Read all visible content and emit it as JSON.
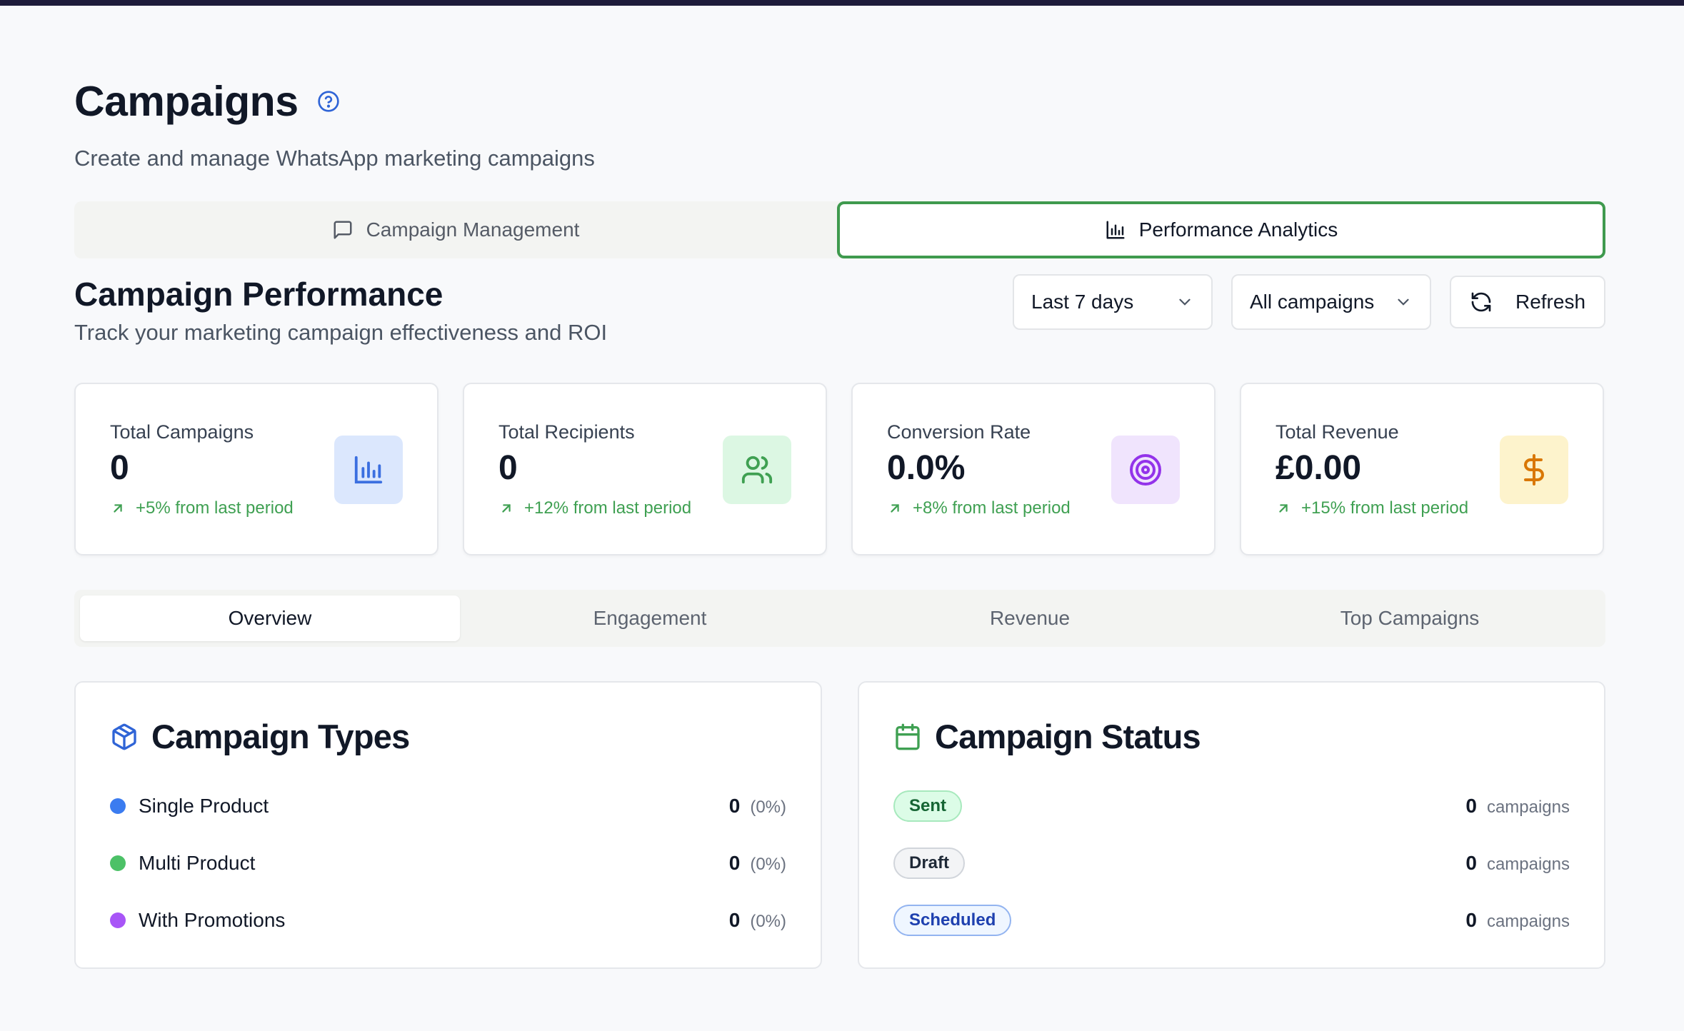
{
  "header": {
    "title": "Campaigns",
    "subtitle": "Create and manage WhatsApp marketing campaigns"
  },
  "main_tabs": [
    {
      "label": "Campaign Management",
      "icon": "message-square-icon",
      "active": false
    },
    {
      "label": "Performance Analytics",
      "icon": "bar-chart-icon",
      "active": true
    }
  ],
  "section": {
    "title": "Campaign Performance",
    "subtitle": "Track your marketing campaign effectiveness and ROI"
  },
  "controls": {
    "range": "Last 7 days",
    "campaign_filter": "All campaigns",
    "refresh_label": "Refresh"
  },
  "stats": [
    {
      "label": "Total Campaigns",
      "value": "0",
      "change": "+5% from last period",
      "icon": "bar-chart-icon",
      "icon_color": "#3b6fe0",
      "icon_bg": "#dbe7fd"
    },
    {
      "label": "Total Recipients",
      "value": "0",
      "change": "+12% from last period",
      "icon": "users-icon",
      "icon_color": "#3fa052",
      "icon_bg": "#dcf7e3"
    },
    {
      "label": "Conversion Rate",
      "value": "0.0%",
      "change": "+8% from last period",
      "icon": "target-icon",
      "icon_color": "#9333ea",
      "icon_bg": "#f0e4fd"
    },
    {
      "label": "Total Revenue",
      "value": "£0.00",
      "change": "+15% from last period",
      "icon": "dollar-icon",
      "icon_color": "#d97706",
      "icon_bg": "#fdf3cc"
    }
  ],
  "sub_tabs": [
    {
      "label": "Overview",
      "active": true
    },
    {
      "label": "Engagement",
      "active": false
    },
    {
      "label": "Revenue",
      "active": false
    },
    {
      "label": "Top Campaigns",
      "active": false
    }
  ],
  "campaign_types": {
    "title": "Campaign Types",
    "items": [
      {
        "label": "Single Product",
        "count": "0",
        "pct": "(0%)",
        "color": "#3b7cf0"
      },
      {
        "label": "Multi Product",
        "count": "0",
        "pct": "(0%)",
        "color": "#4cc167"
      },
      {
        "label": "With Promotions",
        "count": "0",
        "pct": "(0%)",
        "color": "#a855f7"
      }
    ]
  },
  "campaign_status": {
    "title": "Campaign Status",
    "unit": "campaigns",
    "items": [
      {
        "label": "Sent",
        "count": "0"
      },
      {
        "label": "Draft",
        "count": "0"
      },
      {
        "label": "Scheduled",
        "count": "0"
      }
    ]
  },
  "colors": {
    "accent_green": "#3f9a4e",
    "brand_blue": "#2f64d6"
  }
}
